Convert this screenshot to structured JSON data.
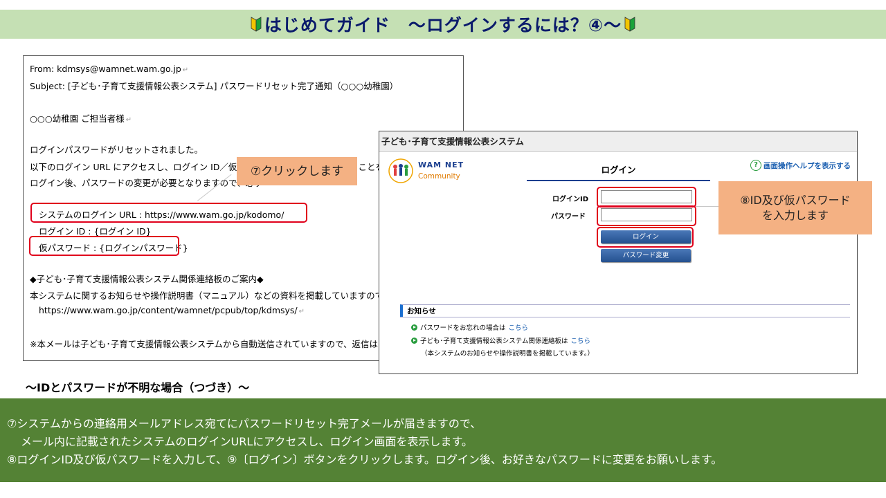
{
  "title": {
    "text": "はじめてガイド　～ログインするには？④～",
    "icon": "beginner-mark-icon",
    "colors": {
      "bar": "#c5e0b4",
      "text": "#0a1a6b"
    }
  },
  "email": {
    "from": "From: kdmsys@wamnet.wam.go.jp",
    "subject": "Subject: [子ども･子育て支援情報公表システム] パスワードリセット完了通知（○○○幼稚園）",
    "greeting": "○○○幼稚園 ご担当者様",
    "body1": "ログインパスワードがリセットされました。",
    "body2": "以下のログイン URL にアクセスし、ログイン ID／仮パスワ",
    "body2_tail": "ることを",
    "body3": "ログイン後、パスワードの変更が必要となりますので、必ず",
    "system_url": "システムのログイン URL : https://www.wam.go.jp/kodomo/",
    "login_id": "ログイン ID : {ログイン ID}",
    "temp_password": "仮パスワード : {ログインパスワード}",
    "notice_title": "◆子ども･子育て支援情報公表システム関係連絡板のご案内◆",
    "notice_body": "本システムに関するお知らせや操作説明書（マニュアル）などの資料を掲載していますので、ぜひ",
    "notice_url": "https://www.wam.go.jp/content/wamnet/pcpub/top/kdmsys/",
    "footer": "※本メールは子ども･子育て支援情報公表システムから自動送信されていますので、返信はしな"
  },
  "callouts": {
    "click": "⑦クリックします",
    "input_line1": "⑧ID及び仮パスワード",
    "input_line2": "を入力します"
  },
  "login_page": {
    "header": "子ども･子育て支援情報公表システム",
    "logo_line1": "WAM NET",
    "logo_line2": "Community",
    "title": "ログイン",
    "help": "画面操作ヘルプを表示する",
    "id_label": "ログインID",
    "password_label": "パスワード",
    "login_button": "ログイン",
    "change_password_button": "パスワード変更",
    "notice_heading": "お知らせ",
    "notice1_text": "パスワードをお忘れの場合は",
    "notice1_link": "こちら",
    "notice2_text": "子ども･子育て支援情報公表システム関係連絡板は",
    "notice2_link": "こちら",
    "notice2_sub": "（本システムのお知らせや操作説明書を掲載しています。）"
  },
  "subheading": "～IDとパスワードが不明な場合（つづき）～",
  "instructions": {
    "line1": "⑦システムからの連絡用メールアドレス宛てにパスワードリセット完了メールが届きますので、",
    "line2": "メール内に記載されたシステムのログインURLにアクセスし、ログイン画面を表示します。",
    "line3": "⑧ログインID及び仮パスワードを入力して、⑨〔ログイン〕ボタンをクリックします。ログイン後、お好きなパスワードに変更をお願いします。",
    "panel_color": "#548235"
  }
}
